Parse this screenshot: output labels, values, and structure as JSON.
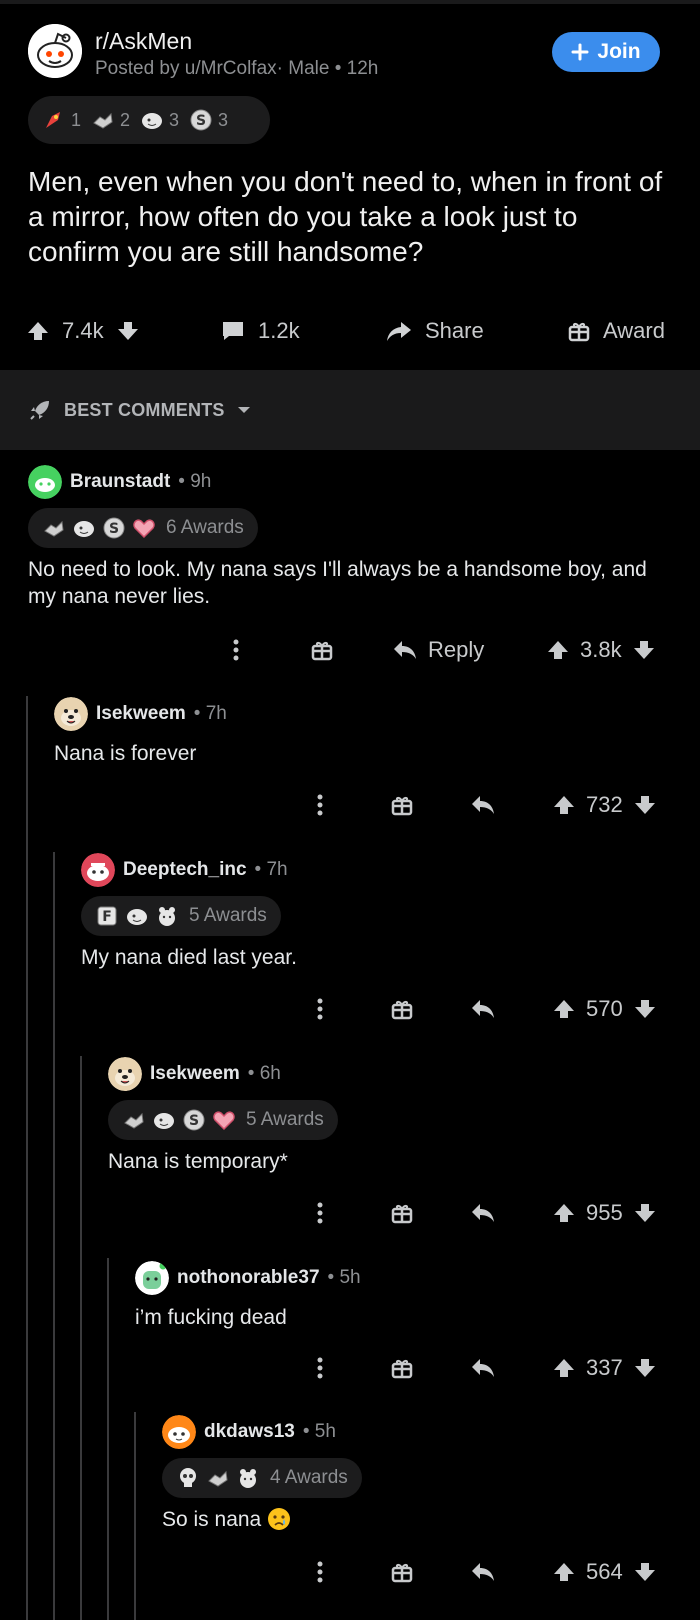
{
  "post": {
    "subreddit": "r/AskMen",
    "posted_by": "Posted by u/MrColfax· Male • 12h",
    "join_label": "Join",
    "awards": [
      {
        "icon": "rocket-like-icon",
        "count": "1"
      },
      {
        "icon": "wholesome-icon",
        "count": "2"
      },
      {
        "icon": "helpful-icon",
        "count": "3"
      },
      {
        "icon": "silver-icon",
        "count": "3"
      }
    ],
    "title": "Men, even when you don't need to, when in front of a mirror, how often do you take a look just to confirm you are still handsome?",
    "upvotes": "7.4k",
    "comments": "1.2k",
    "share_label": "Share",
    "award_label": "Award"
  },
  "sort": {
    "label": "BEST COMMENTS"
  },
  "comments": [
    {
      "user": "Braunstadt",
      "time": "• 9h",
      "awards_label": "6 Awards",
      "award_icons": [
        "wholesome-icon",
        "helpful-icon",
        "silver-icon",
        "heart-icon"
      ],
      "body": "No need to look. My nana says I'll always be a handsome boy, and my nana never lies.",
      "reply_label": "Reply",
      "score": "3.8k"
    },
    {
      "user": "Isekweem",
      "time": "• 7h",
      "body": "Nana is forever",
      "score": "732"
    },
    {
      "user": "Deeptech_inc",
      "time": "• 7h",
      "awards_label": "5 Awards",
      "award_icons": [
        "f-icon",
        "helpful-icon",
        "bear-icon"
      ],
      "body": "My nana died last year.",
      "score": "570"
    },
    {
      "user": "Isekweem",
      "time": "• 6h",
      "awards_label": "5 Awards",
      "award_icons": [
        "wholesome-icon",
        "helpful-icon",
        "silver-icon",
        "heart-icon"
      ],
      "body": "Nana is temporary*",
      "score": "955"
    },
    {
      "user": "nothonorable37",
      "time": "• 5h",
      "body": "i’m fucking dead",
      "score": "337"
    },
    {
      "user": "dkdaws13",
      "time": "• 5h",
      "awards_label": "4 Awards",
      "award_icons": [
        "skull-icon",
        "wholesome-icon",
        "bear-icon"
      ],
      "body": "So is nana",
      "score": "564"
    }
  ],
  "colors": {
    "join": "#3b8ded",
    "bg": "#000000",
    "bar": "#1a1a1b"
  }
}
